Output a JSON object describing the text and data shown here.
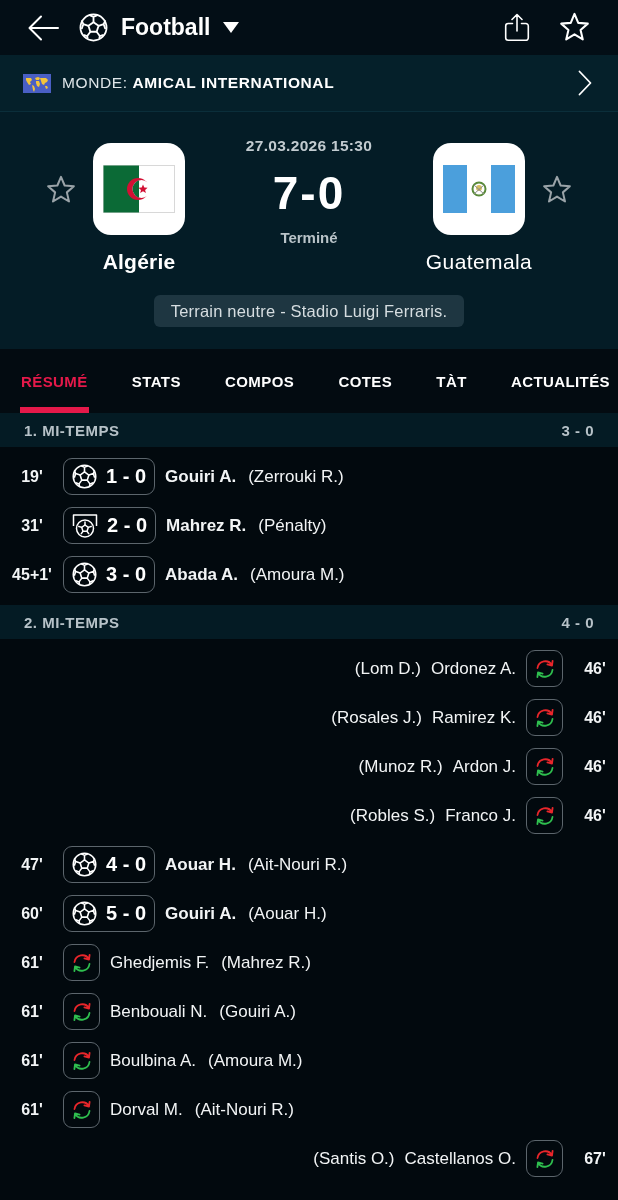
{
  "top_bar": {
    "title": "Football",
    "favorite": false
  },
  "competition": {
    "label": "MONDE: **AMICAL INTERNATIONAL**"
  },
  "match": {
    "datetime": "27.03.2026 15:30",
    "score": "7-0",
    "status": "Terminé",
    "teams": [
      {
        "name": "Algérie",
        "winner": true,
        "favorite": false
      },
      {
        "name": "Guatemala",
        "winner": false,
        "favorite": false
      }
    ],
    "venue": "Terrain neutre - Stadio Luigi Ferraris."
  },
  "tabs": [
    {
      "label": "RÉSUMÉ",
      "selected": true
    },
    {
      "label": "STATS",
      "selected": false
    },
    {
      "label": "COMPOS",
      "selected": false
    },
    {
      "label": "COTES",
      "selected": false
    },
    {
      "label": "TÀT",
      "selected": false
    },
    {
      "label": "ACTUALITÉS",
      "selected": false
    }
  ],
  "periods": [
    {
      "title": "1. MI-TEMPS",
      "score": "3 - 0",
      "events": [
        {
          "away": false,
          "kind": "goal",
          "minute": "19'",
          "score": "1 - 0",
          "player": "Gouiri A.",
          "detail": "(Zerrouki R.)"
        },
        {
          "away": false,
          "kind": "penalty",
          "minute": "31'",
          "score": "2 - 0",
          "player": "Mahrez R.",
          "detail": "(Pénalty)"
        },
        {
          "away": false,
          "kind": "goal",
          "minute": "45+1'",
          "score": "3 - 0",
          "player": "Abada A.",
          "detail": "(Amoura M.)"
        }
      ]
    },
    {
      "title": "2. MI-TEMPS",
      "score": "4 - 0",
      "events": [
        {
          "away": true,
          "kind": "substitution",
          "minute": "46'",
          "player": "Ordonez A.",
          "detail": "(Lom D.)"
        },
        {
          "away": true,
          "kind": "substitution",
          "minute": "46'",
          "player": "Ramirez K.",
          "detail": "(Rosales J.)"
        },
        {
          "away": true,
          "kind": "substitution",
          "minute": "46'",
          "player": "Ardon J.",
          "detail": "(Munoz R.)"
        },
        {
          "away": true,
          "kind": "substitution",
          "minute": "46'",
          "player": "Franco J.",
          "detail": "(Robles S.)"
        },
        {
          "away": false,
          "kind": "goal",
          "minute": "47'",
          "score": "4 - 0",
          "player": "Aouar H.",
          "detail": "(Ait-Nouri R.)"
        },
        {
          "away": false,
          "kind": "goal",
          "minute": "60'",
          "score": "5 - 0",
          "player": "Gouiri A.",
          "detail": "(Aouar H.)"
        },
        {
          "away": false,
          "kind": "substitution",
          "minute": "61'",
          "player": "Ghedjemis F.",
          "detail": "(Mahrez R.)"
        },
        {
          "away": false,
          "kind": "substitution",
          "minute": "61'",
          "player": "Benbouali N.",
          "detail": "(Gouiri A.)"
        },
        {
          "away": false,
          "kind": "substitution",
          "minute": "61'",
          "player": "Boulbina A.",
          "detail": "(Amoura M.)"
        },
        {
          "away": false,
          "kind": "substitution",
          "minute": "61'",
          "player": "Dorval M.",
          "detail": "(Ait-Nouri R.)"
        },
        {
          "away": true,
          "kind": "substitution",
          "minute": "67'",
          "player": "Castellanos O.",
          "detail": "(Santis O.)"
        }
      ]
    }
  ]
}
